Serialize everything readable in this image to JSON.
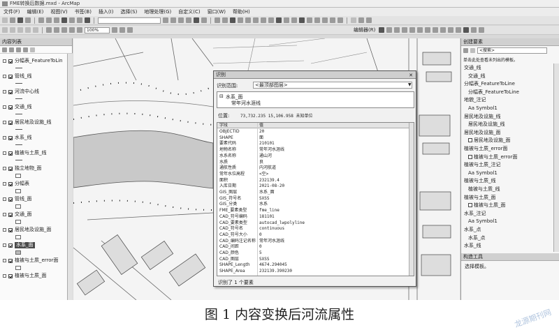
{
  "window": {
    "title": "FME转换后数据.mxd - ArcMap"
  },
  "menu": [
    "文件(F)",
    "编辑(E)",
    "视图(V)",
    "书签(B)",
    "插入(I)",
    "选择(S)",
    "地理处理(G)",
    "自定义(C)",
    "窗口(W)",
    "帮助(H)"
  ],
  "toolbar": {
    "zoom": "100%",
    "editor": "编辑器(R)"
  },
  "toc": {
    "title": "内容列表",
    "layers": [
      "分幅表_FeatureToLin",
      "管线_线",
      "河流中心线",
      "交通_线",
      "居民地及设施_线",
      "水系_线",
      "植被与土质_线",
      "独立地物_面",
      "分幅表",
      "管线_面",
      "交通_面",
      "居民地及设施_面",
      "水系_面",
      "植被与土质_error面",
      "植被与土质_面"
    ]
  },
  "identify": {
    "title": "识别",
    "from_label": "识别范围:",
    "from_value": "<最顶部图层>",
    "tree_root": "水系_面",
    "tree_child": "常年河水涯线",
    "location_label": "位置:",
    "location_value": "73,732.235  15,106.958 未知单位",
    "header": {
      "field": "字段",
      "value": "值"
    },
    "rows": [
      {
        "f": "OBJECTID",
        "v": "20"
      },
      {
        "f": "SHAPE",
        "v": "面"
      },
      {
        "f": "要素代码",
        "v": "210101"
      },
      {
        "f": "地物名称",
        "v": "常年河水涯线"
      },
      {
        "f": "水系名称",
        "v": "通山河"
      },
      {
        "f": "水质",
        "v": "良"
      },
      {
        "f": "通航性质",
        "v": "内河航道"
      },
      {
        "f": "常年水位高程",
        "v": "<空>"
      },
      {
        "f": "面积",
        "v": "232139.4"
      },
      {
        "f": "入库日期",
        "v": "2021-08-20"
      },
      {
        "f": "GIS_图层",
        "v": "水系_面"
      },
      {
        "f": "GIS_符号名",
        "v": "SXSS"
      },
      {
        "f": "GIS_分类",
        "v": "水系"
      },
      {
        "f": "FME_要素类型",
        "v": "fme_line"
      },
      {
        "f": "CAD_符号编码",
        "v": "181101"
      },
      {
        "f": "CAD_要素类型",
        "v": "autocad_lwpolyline"
      },
      {
        "f": "CAD_符号名",
        "v": "continuous"
      },
      {
        "f": "CAD_符号大小",
        "v": "0"
      },
      {
        "f": "CAD_编码注记名称",
        "v": "常年河水涯线"
      },
      {
        "f": "CAD_间距",
        "v": "0"
      },
      {
        "f": "CAD_颜色",
        "v": "5"
      },
      {
        "f": "CAD_图层",
        "v": "SXSS"
      },
      {
        "f": "SHAPE_Length",
        "v": "4674.294045"
      },
      {
        "f": "SHAPE_Area",
        "v": "232139.390230"
      }
    ],
    "status": "识别了 1 个要素"
  },
  "create": {
    "title": "创建要素",
    "search_placeholder": "<搜索>",
    "hint": "单击此处查看未列出的模板。",
    "items": [
      "交通_线",
      "交通_线",
      "分幅表_FeatureToLine",
      "分幅表_FeatureToLine",
      "地貌_注记",
      "Aa Symbol1",
      "居民地及设施_线",
      "居民地及设施_线",
      "居民地及设施_面",
      "居民地及设施_面",
      "植被与土质_error面",
      "植被与土质_error面",
      "植被与土质_注记",
      "Aa Symbol1",
      "植被与土质_线",
      "植被与土质_线",
      "植被与土质_面",
      "植被与土质_面",
      "水系_注记",
      "Aa Symbol1",
      "水系_点",
      "水系_点",
      "水系_线"
    ],
    "tools_title": "构造工具",
    "tools_hint": "选择模板。"
  },
  "caption": "图 1   内容变换后河流属性",
  "watermark": "龙源期刊网"
}
